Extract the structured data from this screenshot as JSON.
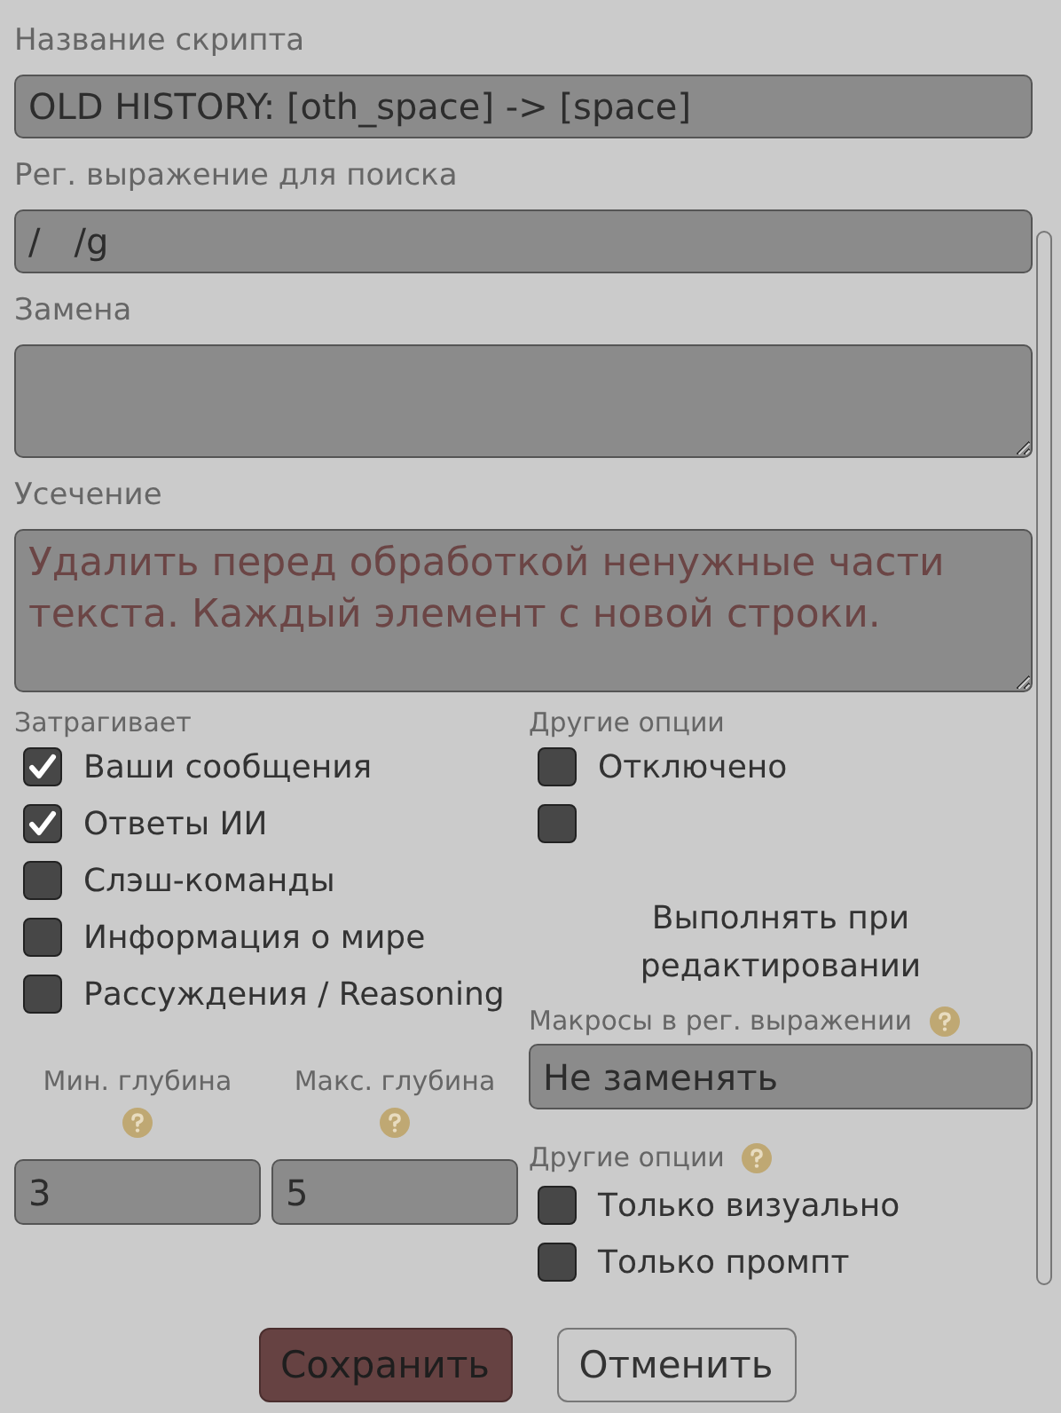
{
  "script_name": {
    "label": "Название скрипта",
    "value": "OLD HISTORY: [oth_space] -> [space]"
  },
  "find_regex": {
    "label": "Рег. выражение для поиска",
    "value": "/   /g"
  },
  "replace": {
    "label": "Замена"
  },
  "trim": {
    "label": "Усечение",
    "placeholder": "Удалить перед обработкой ненужные части текста. Каждый элемент с новой строки."
  },
  "affects": {
    "label": "Затрагивает",
    "items": [
      {
        "label": "Ваши сообщения",
        "checked": true
      },
      {
        "label": "Ответы ИИ",
        "checked": true
      },
      {
        "label": "Слэш-команды",
        "checked": false
      },
      {
        "label": "Информация о мире",
        "checked": false
      },
      {
        "label": "Рассуждения / Reasoning",
        "checked": false
      }
    ]
  },
  "depth": [
    {
      "label": "Мин. глубина",
      "value": "3"
    },
    {
      "label": "Макс. глубина",
      "value": "5"
    }
  ],
  "other_options": {
    "label": "Другие опции",
    "items": [
      {
        "label": "Отключено",
        "checked": false
      },
      {
        "checked": false
      }
    ],
    "note": "Выполнять при редактировании"
  },
  "macros": {
    "label": "Макросы в рег. выражении",
    "value": "Не заменять"
  },
  "other_options_2": {
    "label": "Другие опции",
    "items": [
      {
        "label": "Только визуально",
        "checked": false
      },
      {
        "label": "Только промпт",
        "checked": false
      }
    ]
  },
  "buttons": [
    {
      "label": "Сохранить",
      "kind": "primary"
    },
    {
      "label": "Отменить",
      "kind": "secondary"
    }
  ]
}
